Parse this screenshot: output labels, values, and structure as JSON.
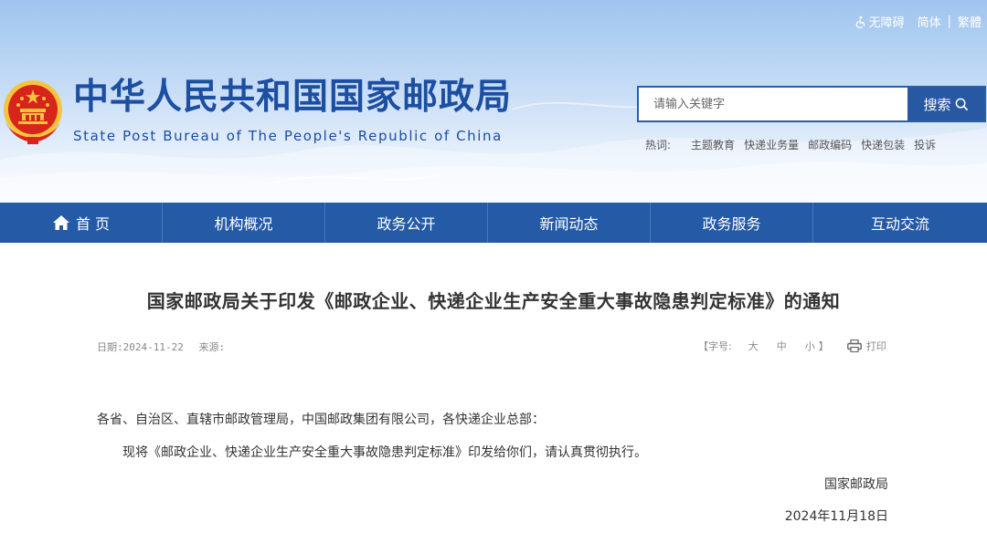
{
  "header": {
    "accessibility_label": "无障碍",
    "lang_simplified": "简体",
    "lang_separator": "|",
    "lang_traditional": "繁體",
    "site_title": "中华人民共和国国家邮政局",
    "site_subtitle": "State Post Bureau of The People's Republic of China",
    "search": {
      "placeholder": "请输入关键字",
      "button_label": "搜索"
    },
    "hotwords": {
      "label": "热词:",
      "items": [
        "主题教育",
        "快递业务量",
        "邮政编码",
        "快递包装",
        "投诉"
      ]
    }
  },
  "nav": {
    "items": [
      {
        "label": "首 页",
        "icon": "home-icon"
      },
      {
        "label": "机构概况"
      },
      {
        "label": "政务公开"
      },
      {
        "label": "新闻动态"
      },
      {
        "label": "政务服务"
      },
      {
        "label": "互动交流"
      }
    ]
  },
  "article": {
    "title": "国家邮政局关于印发《邮政企业、快递企业生产安全重大事故隐患判定标准》的通知",
    "meta": {
      "date_label": "日期:",
      "date_value": "2024-11-22",
      "source_label": "来源:",
      "fontsize_open": "【字号:",
      "size_large": "大",
      "size_medium": "中",
      "size_small": "小",
      "fontsize_close": "】",
      "print_label": "打印"
    },
    "paragraph_1": "各省、自治区、直辖市邮政管理局，中国邮政集团有限公司，各快递企业总部：",
    "paragraph_2": "现将《邮政企业、快递企业生产安全重大事故隐患判定标准》印发给你们，请认真贯彻执行。",
    "signature": "国家邮政局",
    "sign_date": "2024年11月18日"
  },
  "colors": {
    "brand_blue": "#1c4ea1",
    "nav_blue": "#245aa6",
    "emblem_red": "#d8251c",
    "emblem_gold": "#f6c33d"
  }
}
